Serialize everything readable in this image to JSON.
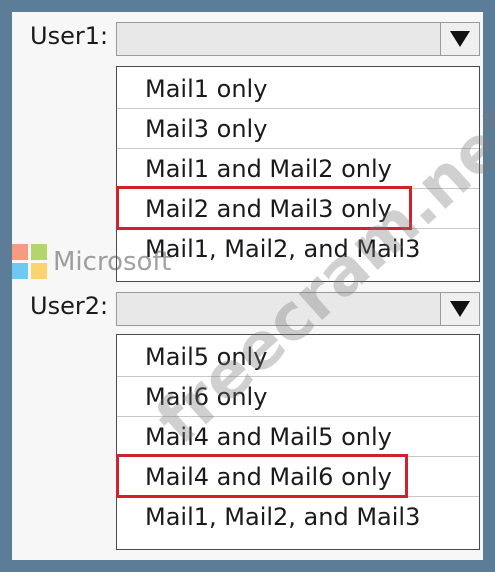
{
  "user1": {
    "label": "User1:",
    "options": [
      "Mail1 only",
      "Mail3 only",
      "Mail1 and Mail2 only",
      "Mail2 and Mail3 only",
      "Mail1, Mail2, and Mail3"
    ],
    "selected_option": "Mail2 and Mail3 only"
  },
  "user2": {
    "label": "User2:",
    "options": [
      "Mail5 only",
      "Mail6 only",
      "Mail4 and Mail5 only",
      "Mail4 and Mail6 only",
      "Mail1, Mail2, and Mail3"
    ],
    "selected_option": "Mail4 and Mail6 only"
  },
  "watermarks": {
    "brand_logo_text": "Microsoft",
    "overlay_text": "freecram.net"
  },
  "colors": {
    "frame_border": "#5b7d98",
    "selection_highlight": "#d0212d",
    "ms_red": "#f25022",
    "ms_green": "#7fba00",
    "ms_blue": "#00a4ef",
    "ms_yellow": "#ffb900"
  },
  "icons": {
    "dropdown_arrow": "triangle-down-icon"
  }
}
